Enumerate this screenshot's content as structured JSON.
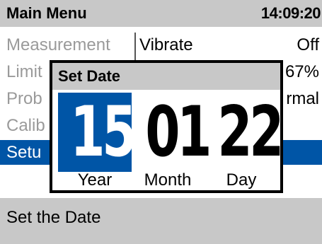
{
  "header": {
    "title": "Main Menu",
    "clock": "14:09:20"
  },
  "menu": {
    "items": [
      {
        "label": "Measurement"
      },
      {
        "label": "Limit"
      },
      {
        "label": "Prob"
      },
      {
        "label": "Calib"
      },
      {
        "label": "Setu"
      }
    ]
  },
  "values": {
    "row1_left": "Vibrate",
    "row1_right": "Off",
    "row2_right": "67%",
    "row3_right": "rmal"
  },
  "dialog": {
    "title": "Set Date",
    "fields": [
      {
        "value": "15",
        "label": "Year"
      },
      {
        "value": "01",
        "label": "Month"
      },
      {
        "value": "22",
        "label": "Day"
      }
    ]
  },
  "status": {
    "text": "Set the Date"
  },
  "colors": {
    "selected": "#0055a6",
    "panel_gray": "#c8c8c8"
  }
}
